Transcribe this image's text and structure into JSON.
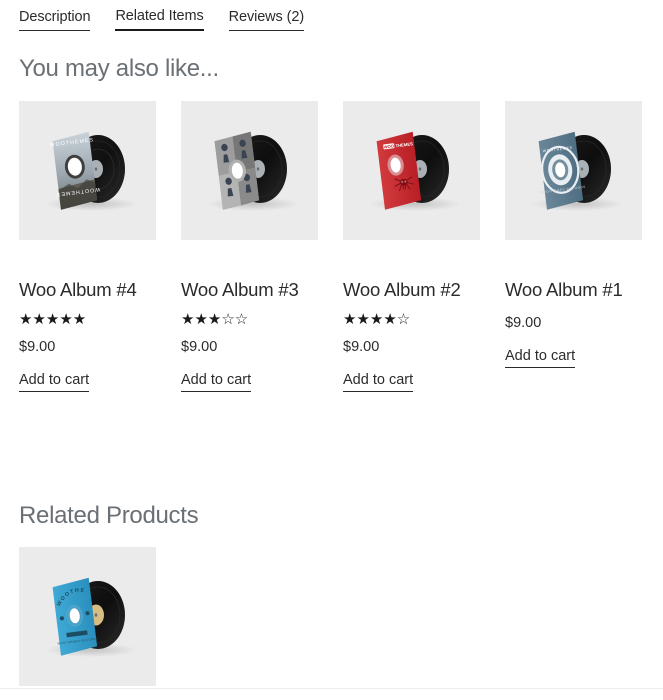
{
  "tabs": [
    {
      "label": "Description",
      "active": false
    },
    {
      "label": "Related Items",
      "active": true
    },
    {
      "label": "Reviews (2)",
      "active": false
    }
  ],
  "sections": {
    "also_like_heading": "You may also like...",
    "related_heading": "Related Products"
  },
  "labels": {
    "add_to_cart": "Add to cart"
  },
  "colors": {
    "thumb_background": "#ebebeb",
    "heading_text": "#6b7075",
    "body_text": "#2b2b2b",
    "star_filled": "#1a1a1a",
    "rule": "#ececec"
  },
  "also_like_products": [
    {
      "title": "Woo Album #4",
      "price": "$9.00",
      "add_to_cart": "Add to cart",
      "rating_filled": 5,
      "rating_total": 5,
      "rating_stars": "★★★★★",
      "cover": {
        "name": "woo-album-4-cover",
        "style": "photo",
        "sleeve_color": "#8a9099",
        "label_text": "WOOTHEMES"
      }
    },
    {
      "title": "Woo Album #3",
      "price": "$9.00",
      "add_to_cart": "Add to cart",
      "rating_filled": 3,
      "rating_total": 5,
      "rating_stars": "★★★☆☆",
      "cover": {
        "name": "woo-album-3-cover",
        "style": "quadrants",
        "sleeve_color": "#9a9a9a",
        "label_text": ""
      }
    },
    {
      "title": "Woo Album #2",
      "price": "$9.00",
      "add_to_cart": "Add to cart",
      "rating_filled": 4,
      "rating_total": 5,
      "rating_stars": "★★★★☆",
      "cover": {
        "name": "woo-album-2-cover",
        "style": "red",
        "sleeve_color": "#cc2229",
        "label_text": "WOOTHEMES"
      }
    },
    {
      "title": "Woo Album #1",
      "price": "$9.00",
      "add_to_cart": "Add to cart",
      "rating_filled": 0,
      "rating_total": 0,
      "rating_stars": "",
      "cover": {
        "name": "woo-album-1-cover",
        "style": "ring",
        "sleeve_color": "#5d7b8e",
        "label_text": "WOOTHEMES"
      }
    }
  ],
  "related_products": [
    {
      "title": "",
      "price": "",
      "add_to_cart": "",
      "rating_stars": "",
      "cover": {
        "name": "woo-logo-album-cover",
        "style": "blue",
        "sleeve_color": "#339fc9",
        "label_text": "WOOTHEMES"
      }
    }
  ]
}
